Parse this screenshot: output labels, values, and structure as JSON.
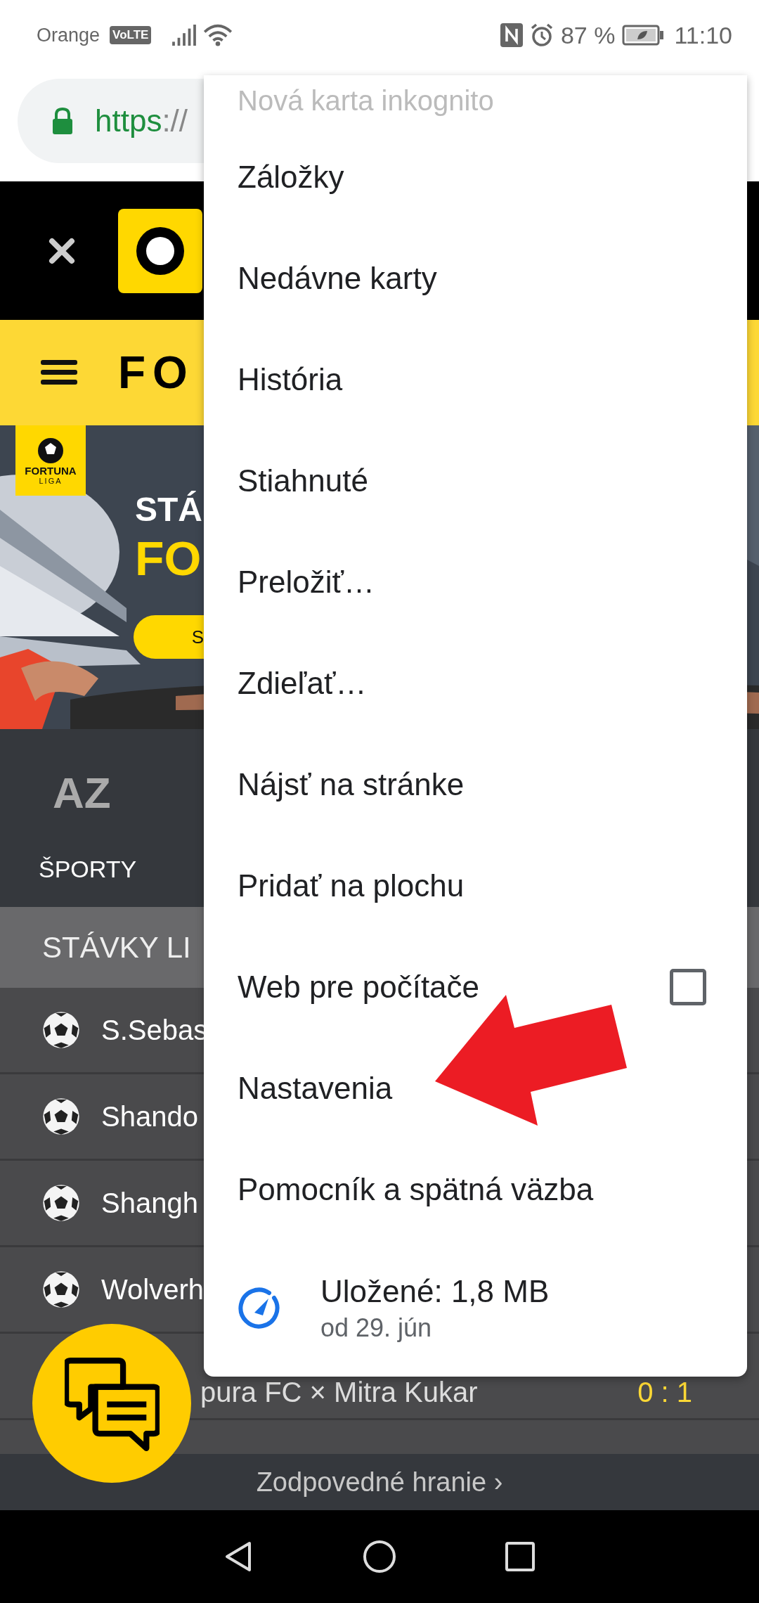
{
  "status_bar": {
    "carrier": "Orange",
    "volte": "VoLTE",
    "battery_text": "87 %",
    "time": "11:10"
  },
  "address_bar": {
    "scheme": "https",
    "rest": "://"
  },
  "site_header": {
    "brand": "FO"
  },
  "banner": {
    "badge_top": "FORTUNA",
    "badge_bottom": "LIGA",
    "headline_1": "STÁ",
    "headline_2": "FO",
    "button": "S"
  },
  "sport_nav": {
    "az": "AZ",
    "label": "ŠPORTY"
  },
  "live_section": {
    "title": "STÁVKY LI"
  },
  "matches": [
    {
      "name": "S.Sebas"
    },
    {
      "name": "Shando"
    },
    {
      "name": "Shangh"
    },
    {
      "name": "Wolverh"
    }
  ],
  "partial_match": {
    "name": "pura FC × Mitra Kukar",
    "score": "0 : 1"
  },
  "footer_link": "Zodpovedné hranie ›",
  "menu": {
    "items": [
      {
        "kind": "faded",
        "label": "Nová karta inkognito"
      },
      {
        "kind": "plain",
        "label": "Záložky"
      },
      {
        "kind": "plain",
        "label": "Nedávne karty"
      },
      {
        "kind": "plain",
        "label": "História"
      },
      {
        "kind": "plain",
        "label": "Stiahnuté"
      },
      {
        "kind": "plain",
        "label": "Preložiť…"
      },
      {
        "kind": "plain",
        "label": "Zdieľať…"
      },
      {
        "kind": "plain",
        "label": "Nájsť na stránke"
      },
      {
        "kind": "plain",
        "label": "Pridať na plochu"
      },
      {
        "kind": "checkbox",
        "label": "Web pre počítače",
        "checked": false
      },
      {
        "kind": "plain",
        "label": "Nastavenia"
      },
      {
        "kind": "plain",
        "label": "Pomocník a spätná väzba"
      },
      {
        "kind": "data_saver",
        "label": "Uložené: 1,8 MB",
        "subtitle": "od 29. jún"
      }
    ]
  }
}
